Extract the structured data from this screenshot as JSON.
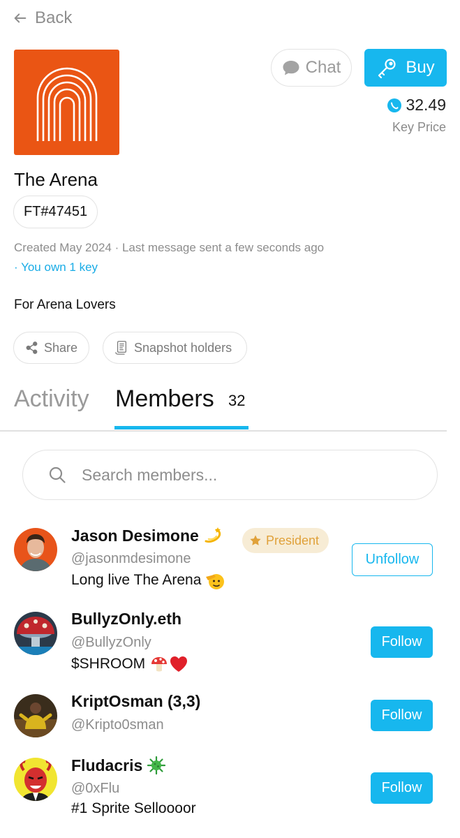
{
  "nav": {
    "back_label": "Back"
  },
  "group": {
    "title": "The Arena",
    "ft_id": "FT#47451",
    "meta": "Created May 2024 · Last message sent a few seconds ago",
    "own_keys": "· You own 1 key",
    "description": "For Arena Lovers",
    "logo_icon": "arena-arch-logo",
    "brand_color": "#ea5514"
  },
  "actions": {
    "chat_label": "Chat",
    "buy_label": "Buy",
    "share_label": "Share",
    "snapshot_label": "Snapshot holders"
  },
  "price": {
    "value": "32.49",
    "label": "Key Price",
    "coin_icon": "avax-coin-icon"
  },
  "tabs": {
    "activity": "Activity",
    "members": "Members",
    "members_count": "32",
    "accent": "#17b7ee"
  },
  "search": {
    "placeholder": "Search members..."
  },
  "members": [
    {
      "name": "Jason Desimone",
      "name_emoji": "dizzy-emoji",
      "badge": "President",
      "handle": "@jasonmdesimone",
      "bio": "Long live The Arena",
      "bio_emoji": "saluting-face-emoji",
      "action": "Unfollow"
    },
    {
      "name": "BullyzOnly.eth",
      "handle": "@BullyzOnly",
      "bio": "$SHROOM",
      "bio_emoji": "mushroom-heart-emoji",
      "action": "Follow"
    },
    {
      "name": "KriptOsman (3,3)",
      "handle": "@Kripto0sman",
      "bio": "",
      "action": "Follow"
    },
    {
      "name": "Fludacris",
      "name_emoji": "virus-emoji",
      "handle": "@0xFlu",
      "bio": "#1 Sprite Selloooor",
      "action": "Follow"
    }
  ]
}
